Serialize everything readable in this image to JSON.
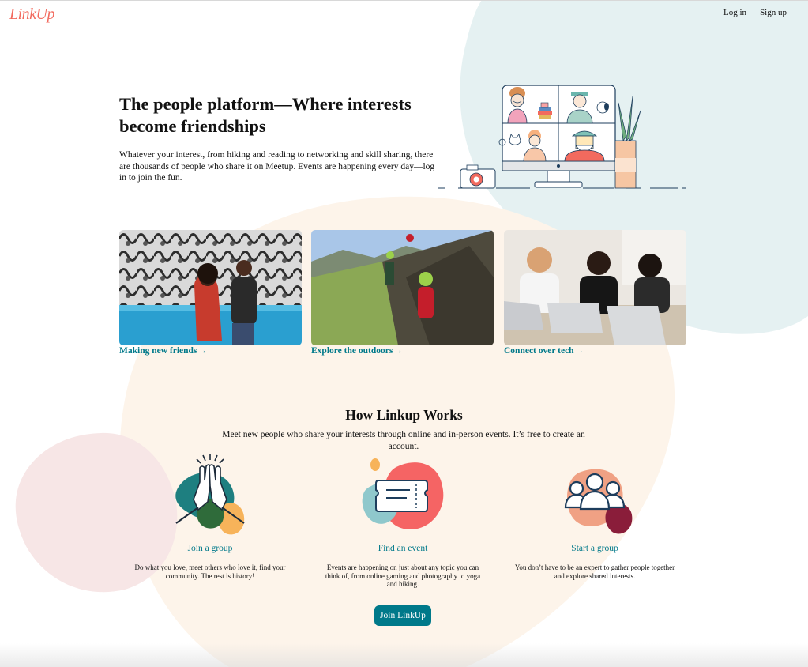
{
  "app": {
    "logo": "LinkUp"
  },
  "nav": {
    "login": "Log in",
    "signup": "Sign up"
  },
  "hero": {
    "title": "The people platform—Where interests become friendships",
    "text": "Whatever your interest, from hiking and reading to networking and skill sharing, there are thousands of people who share it on Meetup. Events are happening every day—log in to join the fun."
  },
  "cards": [
    {
      "label": "Making new friends"
    },
    {
      "label": "Explore the outdoors"
    },
    {
      "label": "Connect over tech"
    }
  ],
  "how": {
    "title": "How Linkup Works",
    "subtitle": "Meet new people who share your interests through online and in-person events. It’s free to create an account."
  },
  "features": [
    {
      "label": "Join a group",
      "desc": "Do what you love, meet others who love it, find your community. The rest is history!",
      "icon": "high-five-icon"
    },
    {
      "label": "Find an event",
      "desc": "Events are happening on just about any topic you can think of, from online gaming and photography to yoga and hiking.",
      "icon": "ticket-icon"
    },
    {
      "label": "Start a group",
      "desc": "You don’t have to be an expert to gather people together and explore shared interests.",
      "icon": "people-group-icon"
    }
  ],
  "cta": {
    "label": "Join LinkUp"
  },
  "colors": {
    "accent": "#00798a",
    "brand": "#f26a5e",
    "blob_blue": "#e6f2f2",
    "blob_peach": "#fef6ee",
    "blob_pink": "#f8e8e8"
  }
}
